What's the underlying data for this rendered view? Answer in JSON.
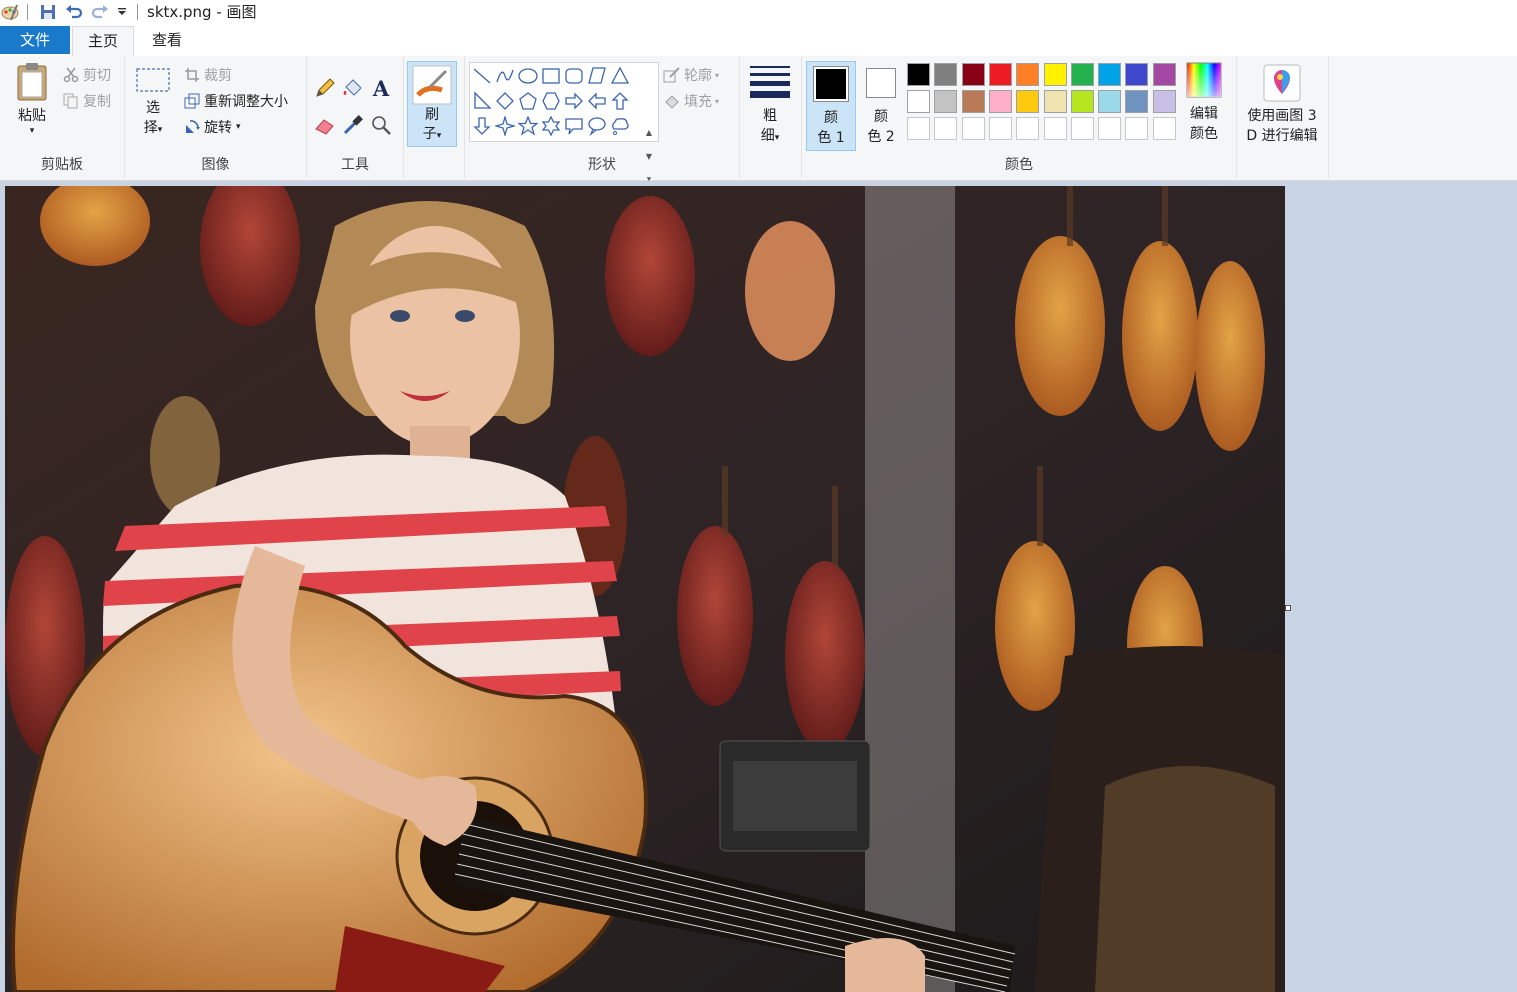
{
  "window": {
    "title": "sktx.png - 画图"
  },
  "quick_access": {
    "icons": [
      "paint-app-icon",
      "save-icon",
      "undo-icon",
      "redo-icon",
      "customize-dropdown-icon"
    ]
  },
  "tabs": {
    "file": "文件",
    "home": "主页",
    "view": "查看"
  },
  "clipboard": {
    "paste_line1": "粘贴",
    "cut": "剪切",
    "copy": "复制",
    "label": "剪贴板"
  },
  "image": {
    "select_line1": "选",
    "select_line2": "择",
    "crop": "裁剪",
    "resize": "重新调整大小",
    "rotate": "旋转",
    "label": "图像"
  },
  "tools": {
    "label": "工具",
    "items": [
      "pencil-icon",
      "fill-bucket-icon",
      "text-icon",
      "eraser-icon",
      "color-picker-icon",
      "magnifier-icon"
    ]
  },
  "brushes": {
    "line1": "刷",
    "line2": "子"
  },
  "shapes": {
    "outline": "轮廓",
    "fill": "填充",
    "label": "形状"
  },
  "size": {
    "line1": "粗",
    "line2": "细"
  },
  "colors": {
    "color1_line1": "颜",
    "color1_line2": "色 1",
    "color2_line1": "颜",
    "color2_line2": "色 2",
    "edit_line1": "编辑",
    "edit_line2": "颜色",
    "label": "颜色",
    "color1": "#000000",
    "color2": "#ffffff",
    "palette_row1": [
      "#000000",
      "#7f7f7f",
      "#880015",
      "#ed1c24",
      "#ff7f27",
      "#fff200",
      "#22b14c",
      "#00a2e8",
      "#3f48cc",
      "#a349a4"
    ],
    "palette_row2": [
      "#ffffff",
      "#c3c3c3",
      "#b97a57",
      "#ffaec9",
      "#ffc90e",
      "#efe4b0",
      "#b5e61d",
      "#99d9ea",
      "#7092be",
      "#c8bfe7"
    ],
    "palette_row3": [
      "#ffffff",
      "#ffffff",
      "#ffffff",
      "#ffffff",
      "#ffffff",
      "#ffffff",
      "#ffffff",
      "#ffffff",
      "#ffffff",
      "#ffffff"
    ]
  },
  "paint3d": {
    "line1": "使用画图 3",
    "line2": "D 进行编辑"
  }
}
